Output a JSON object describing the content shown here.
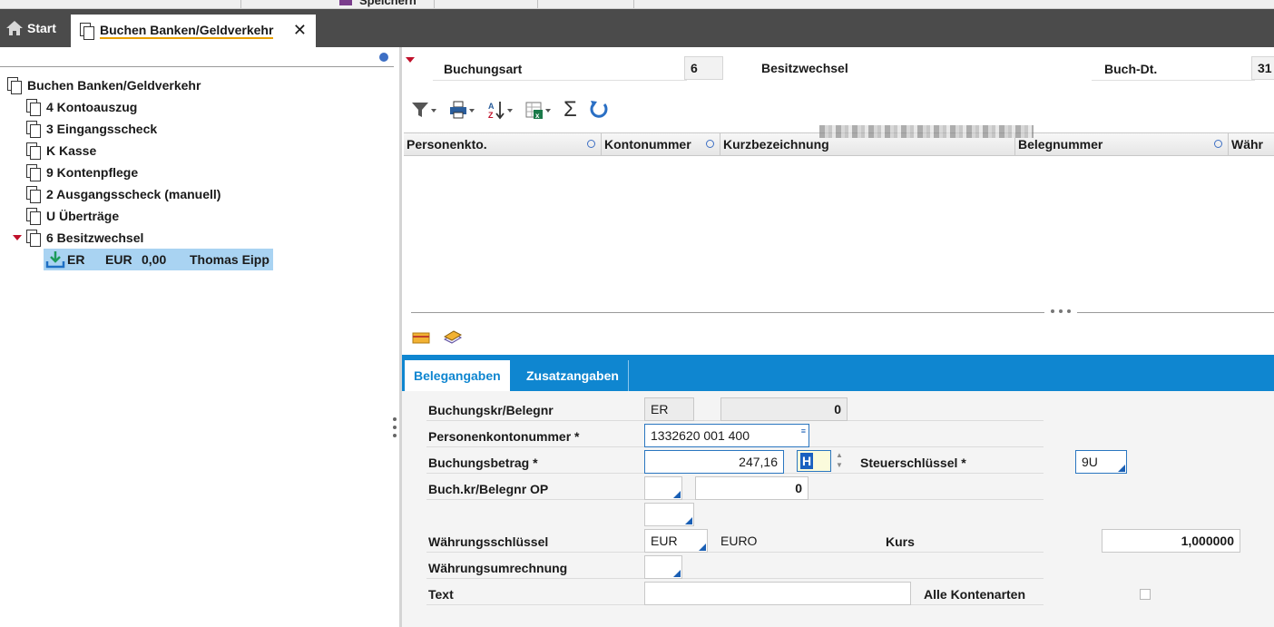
{
  "top_strip": {
    "save_label": "Speichern"
  },
  "tabs": {
    "start": "Start",
    "active": "Buchen Banken/Geldverkehr"
  },
  "tree": {
    "root": "Buchen Banken/Geldverkehr",
    "items": [
      "4 Kontoauszug",
      "3 Eingangsscheck",
      "K Kasse",
      "9 Kontenpflege",
      "2 Ausgangsscheck (manuell)",
      "U Überträge",
      "6 Besitzwechsel"
    ],
    "selected": {
      "code": "ER",
      "currency": "EUR",
      "amount": "0,00",
      "name": "Thomas Eipp"
    }
  },
  "header": {
    "buchungsart_label": "Buchungsart",
    "buchungsart_value": "6",
    "buchungsart_name": "Besitzwechsel",
    "buch_dt_label": "Buch-Dt.",
    "buch_dt_value": "31"
  },
  "toolbar": [
    "filter-icon",
    "print-icon",
    "sort-icon",
    "excel-export-icon",
    "sum-icon",
    "refresh-icon"
  ],
  "grid": {
    "columns": [
      "Personenkto.",
      "Kontonummer",
      "Kurzbezeichnung",
      "Belegnummer",
      "Währ"
    ]
  },
  "form_tabs": [
    "Belegangaben",
    "Zusatzangaben"
  ],
  "form": {
    "buchungskreis_label": "Buchungskr/Belegnr",
    "buchungskreis_value": "ER",
    "belegnr_value": "0",
    "personenkonto_label": "Personenkontonummer *",
    "personenkonto_value": "1332620 001 400",
    "buchungsbetrag_label": "Buchungsbetrag *",
    "buchungsbetrag_value": "247,16",
    "soll_haben_value": "H",
    "steuerschluessel_label": "Steuerschlüssel *",
    "steuerschluessel_value": "9U",
    "op_label": "Buch.kr/Belegnr OP",
    "op_kreis_value": "",
    "op_nr_value": "0",
    "extra_value": "",
    "waehrung_label": "Währungsschlüssel",
    "waehrung_value": "EUR",
    "waehrung_name": "EURO",
    "kurs_label": "Kurs",
    "kurs_value": "1,000000",
    "umrechnung_label": "Währungsumrechnung",
    "umrechnung_value": "",
    "text_label": "Text",
    "text_value": "",
    "alle_kontenarten_label": "Alle Kontenarten"
  },
  "colors": {
    "tabbar": "#4b4b4b",
    "accent_blue": "#0f86d0",
    "selection": "#a9d3f2",
    "tab_underline": "#e8a000"
  }
}
